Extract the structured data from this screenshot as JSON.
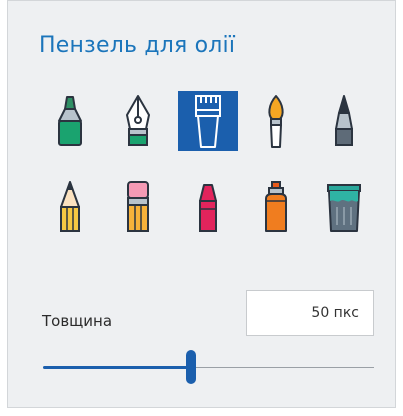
{
  "panel": {
    "title": "Пензель для олії"
  },
  "tools": [
    {
      "icon": "marker-icon",
      "selected": false
    },
    {
      "icon": "calligraphy-pen-icon",
      "selected": false
    },
    {
      "icon": "oil-brush-icon",
      "selected": true
    },
    {
      "icon": "watercolor-brush-icon",
      "selected": false
    },
    {
      "icon": "fine-pen-icon",
      "selected": false
    },
    {
      "icon": "pencil-icon",
      "selected": false
    },
    {
      "icon": "eraser-icon",
      "selected": false
    },
    {
      "icon": "crayon-icon",
      "selected": false
    },
    {
      "icon": "spray-can-icon",
      "selected": false
    },
    {
      "icon": "fill-bucket-icon",
      "selected": false
    }
  ],
  "thickness": {
    "label": "Товщина",
    "value": "50 пкс",
    "level": 0.45
  },
  "colors": {
    "accent": "#1b75bb",
    "selected_bg": "#1b5fad"
  }
}
